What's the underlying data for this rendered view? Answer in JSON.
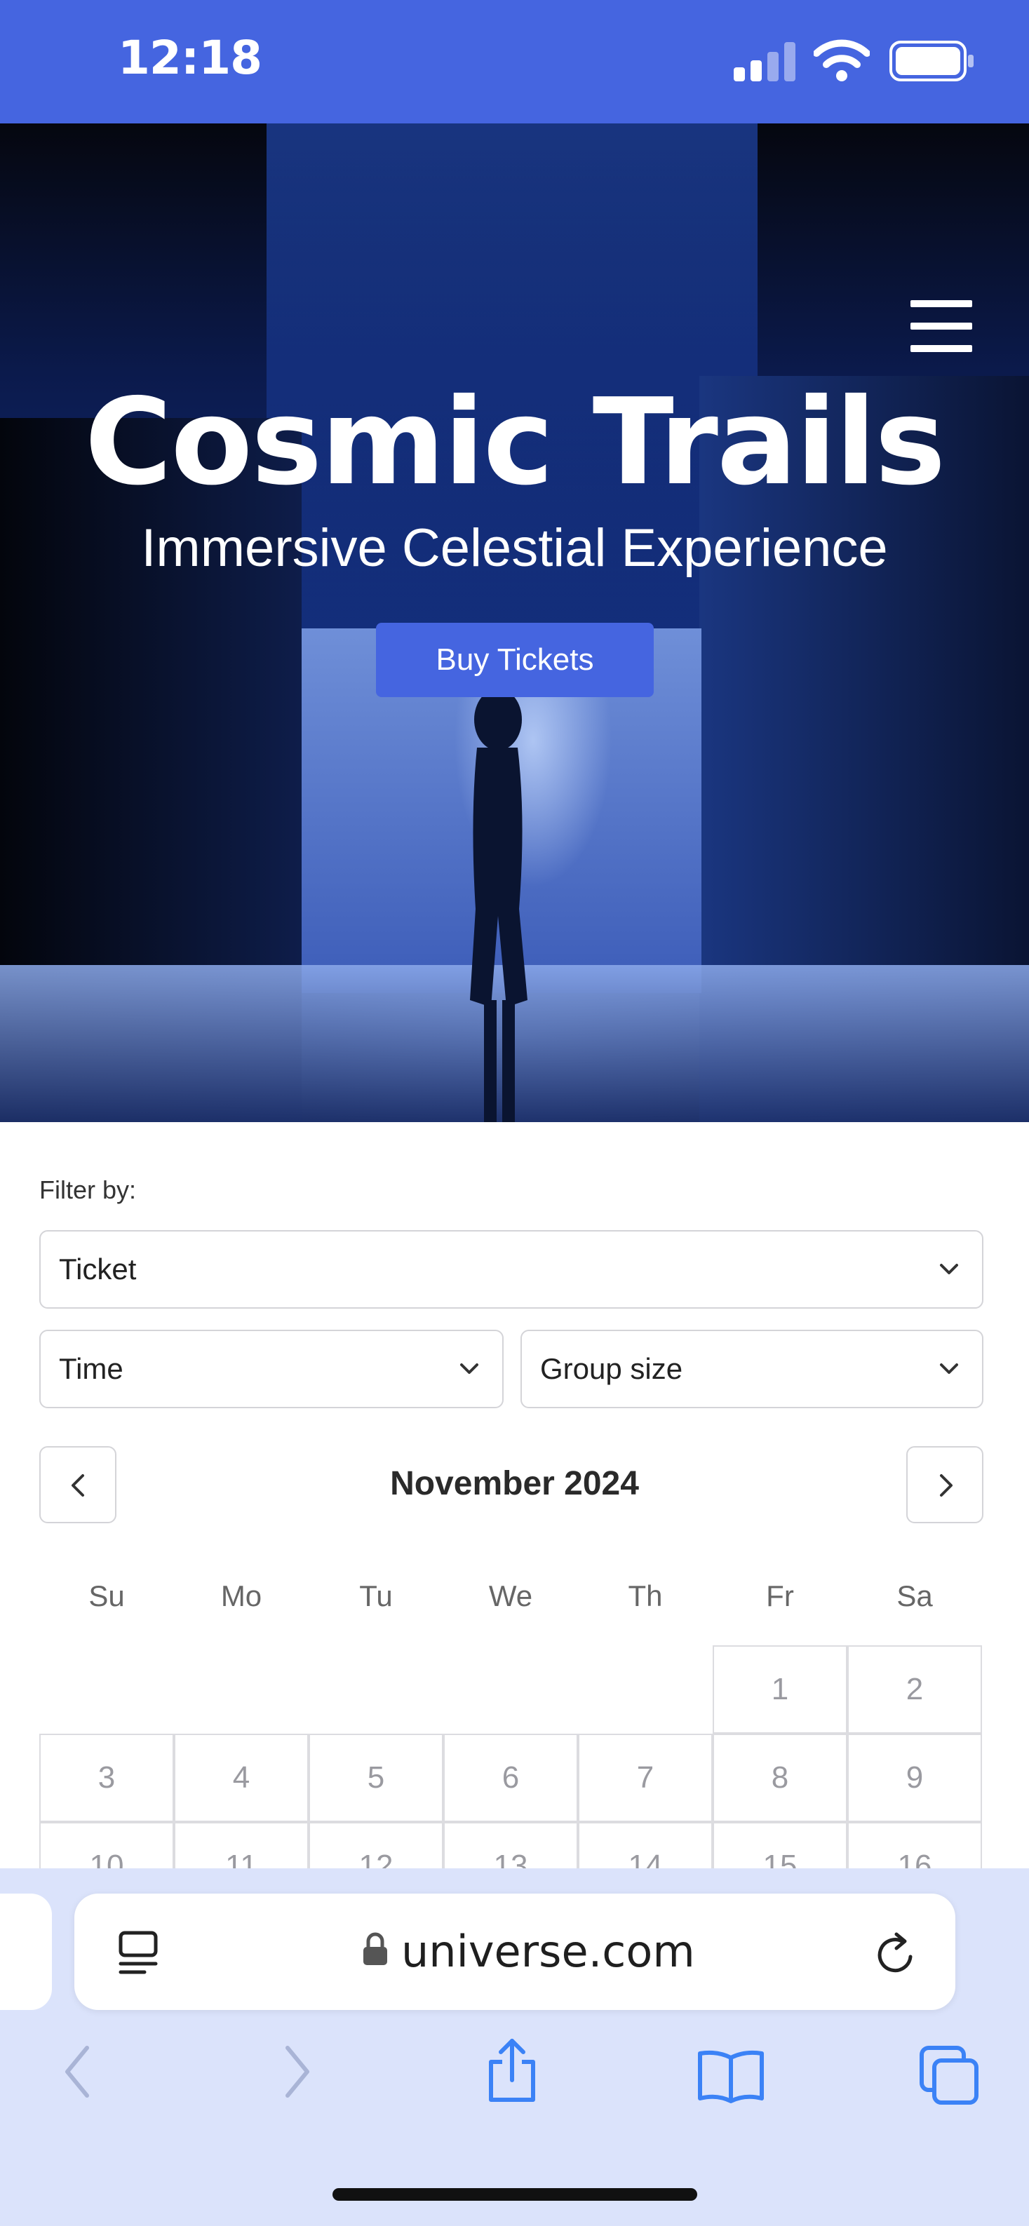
{
  "status_bar": {
    "time": "12:18"
  },
  "hero": {
    "title": "Cosmic Trails",
    "subtitle": "Immersive Celestial Experience",
    "cta_label": "Buy Tickets"
  },
  "filter": {
    "label": "Filter by:",
    "ticket": "Ticket",
    "time": "Time",
    "group_size": "Group size"
  },
  "calendar": {
    "month": "November 2024",
    "weekdays": [
      "Su",
      "Mo",
      "Tu",
      "We",
      "Th",
      "Fr",
      "Sa"
    ],
    "weeks": [
      [
        "",
        "",
        "",
        "",
        "",
        "1",
        "2"
      ],
      [
        "3",
        "4",
        "5",
        "6",
        "7",
        "8",
        "9"
      ],
      [
        "10",
        "11",
        "12",
        "13",
        "14",
        "15",
        "16"
      ]
    ]
  },
  "browser": {
    "url": "universe.com"
  },
  "colors": {
    "brand_blue": "#4565e0",
    "browser_bg": "#dbe3fb"
  }
}
